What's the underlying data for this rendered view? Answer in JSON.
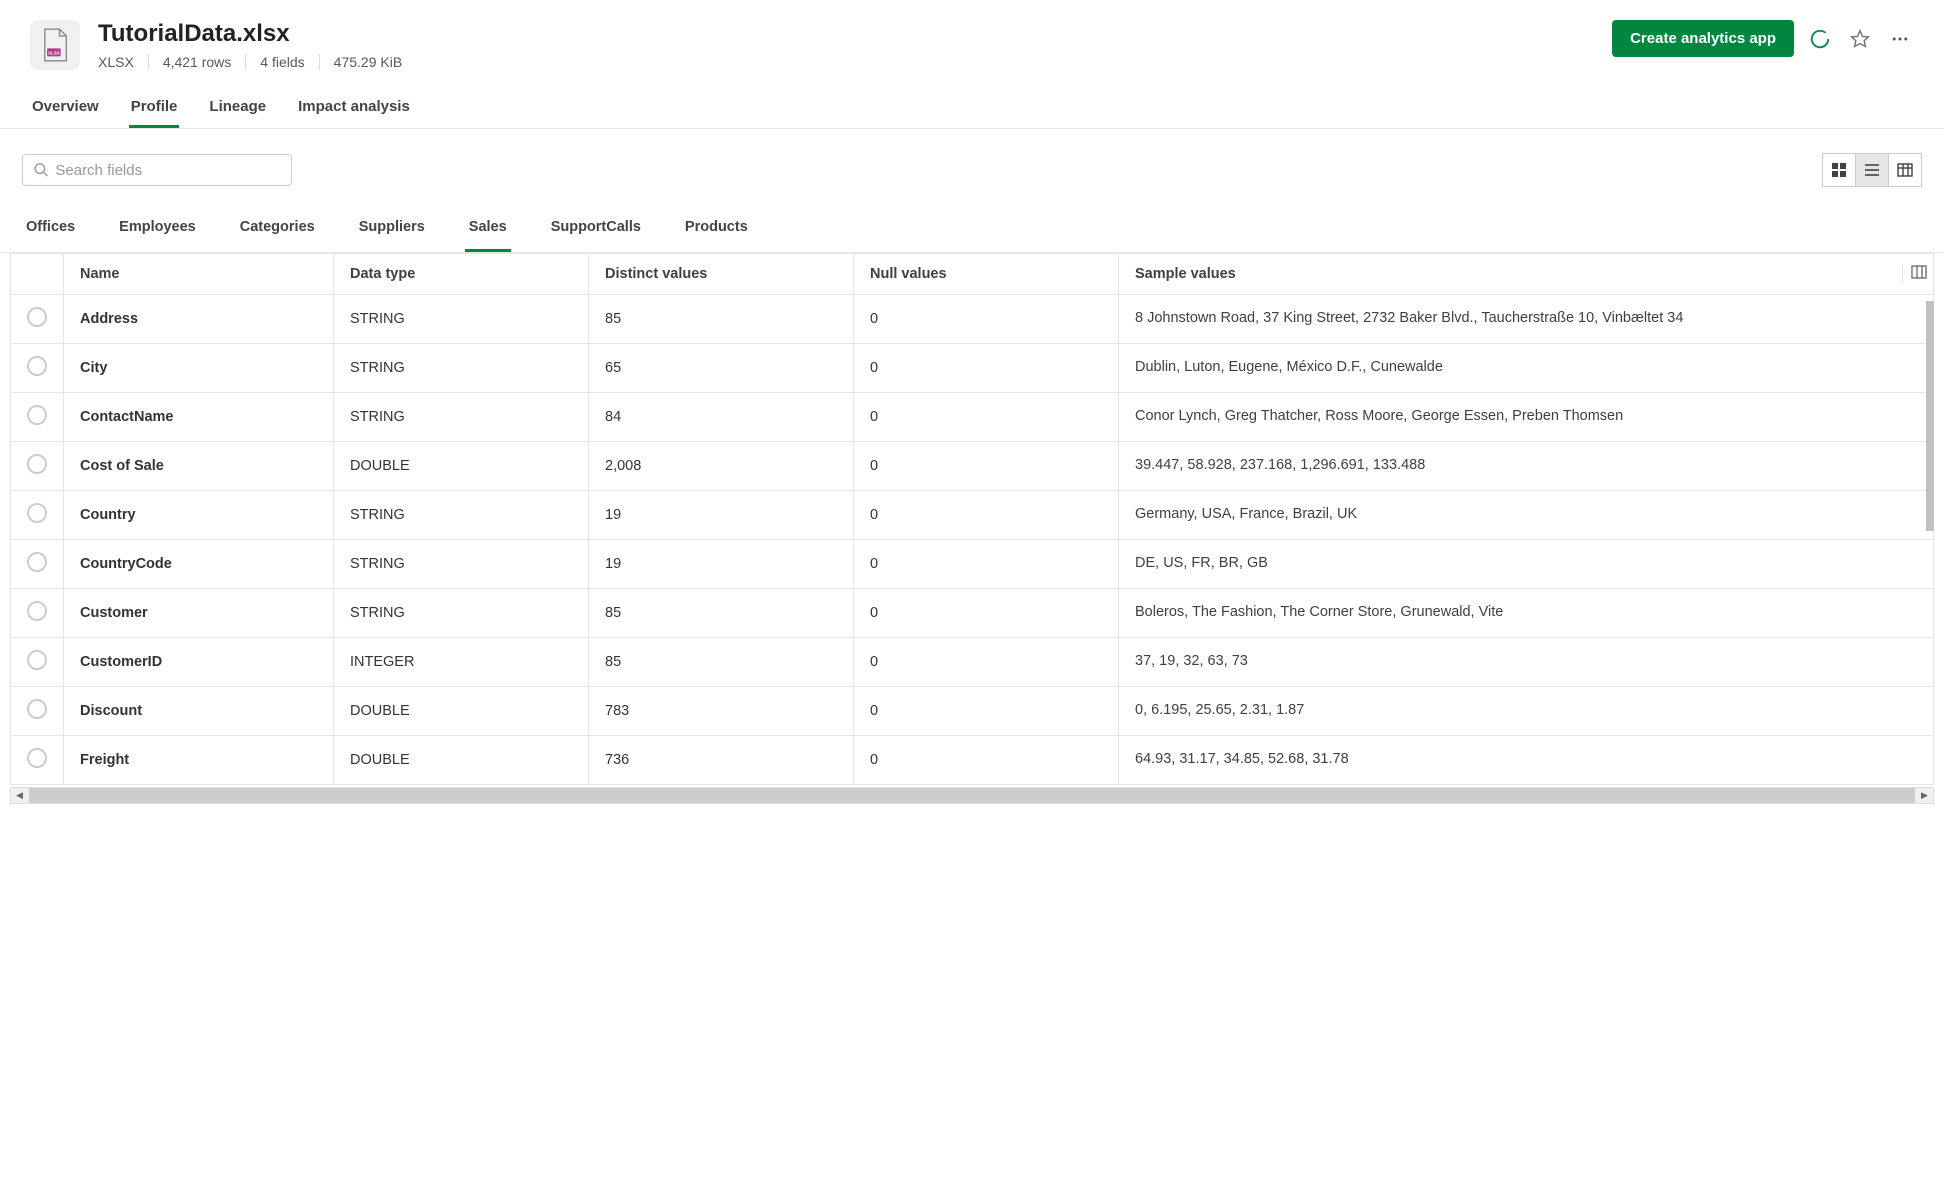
{
  "header": {
    "title": "TutorialData.xlsx",
    "file_type": "XLSX",
    "rows": "4,421 rows",
    "fields": "4 fields",
    "size": "475.29 KiB",
    "create_btn": "Create analytics app"
  },
  "main_tabs": [
    "Overview",
    "Profile",
    "Lineage",
    "Impact analysis"
  ],
  "main_tab_active": 1,
  "search": {
    "placeholder": "Search fields"
  },
  "sub_tabs": [
    "Offices",
    "Employees",
    "Categories",
    "Suppliers",
    "Sales",
    "SupportCalls",
    "Products"
  ],
  "sub_tab_active": 4,
  "columns": [
    "Name",
    "Data type",
    "Distinct values",
    "Null values",
    "Sample values"
  ],
  "rows": [
    {
      "name": "Address",
      "type": "STRING",
      "distinct": "85",
      "null": "0",
      "sample": "8 Johnstown Road, 37 King Street, 2732 Baker Blvd., Taucherstraße 10, Vinbæltet 34"
    },
    {
      "name": "City",
      "type": "STRING",
      "distinct": "65",
      "null": "0",
      "sample": "Dublin, Luton, Eugene, México D.F., Cunewalde"
    },
    {
      "name": "ContactName",
      "type": "STRING",
      "distinct": "84",
      "null": "0",
      "sample": "Conor Lynch, Greg Thatcher, Ross Moore, George Essen, Preben Thomsen"
    },
    {
      "name": "Cost of Sale",
      "type": "DOUBLE",
      "distinct": "2,008",
      "null": "0",
      "sample": "39.447, 58.928, 237.168, 1,296.691, 133.488"
    },
    {
      "name": "Country",
      "type": "STRING",
      "distinct": "19",
      "null": "0",
      "sample": "Germany, USA, France, Brazil, UK"
    },
    {
      "name": "CountryCode",
      "type": "STRING",
      "distinct": "19",
      "null": "0",
      "sample": "DE, US, FR, BR, GB"
    },
    {
      "name": "Customer",
      "type": "STRING",
      "distinct": "85",
      "null": "0",
      "sample": "Boleros, The Fashion, The Corner Store, Grunewald, Vite"
    },
    {
      "name": "CustomerID",
      "type": "INTEGER",
      "distinct": "85",
      "null": "0",
      "sample": "37, 19, 32, 63, 73"
    },
    {
      "name": "Discount",
      "type": "DOUBLE",
      "distinct": "783",
      "null": "0",
      "sample": "0, 6.195, 25.65, 2.31, 1.87"
    },
    {
      "name": "Freight",
      "type": "DOUBLE",
      "distinct": "736",
      "null": "0",
      "sample": "64.93, 31.17, 34.85, 52.68, 31.78"
    }
  ]
}
